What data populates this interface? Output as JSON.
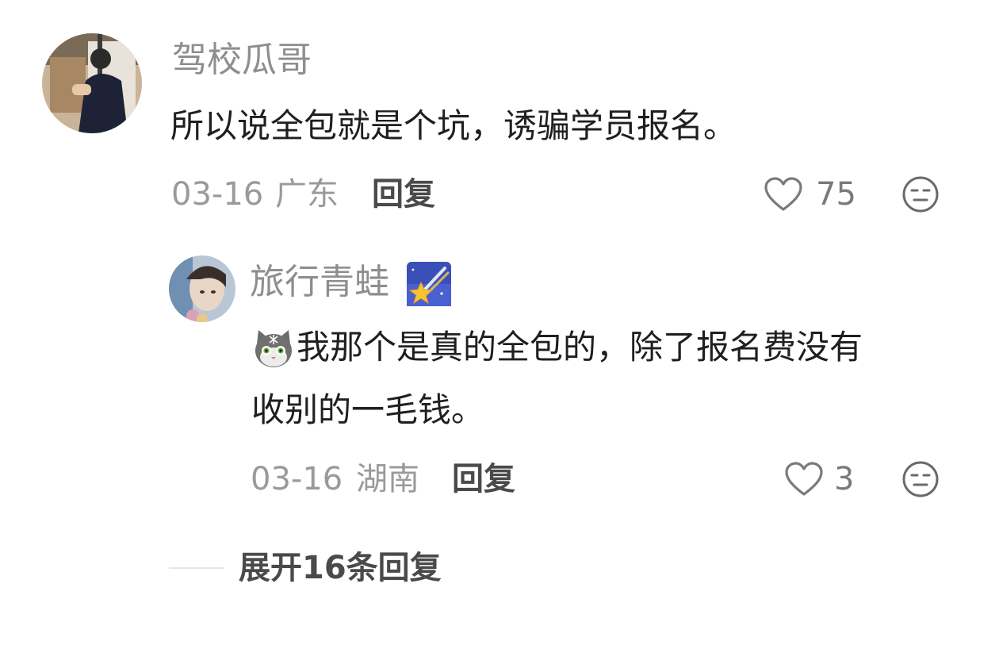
{
  "comment": {
    "username": "驾校瓜哥",
    "text": "所以说全包就是个坑，诱骗学员报名。",
    "date": "03-16",
    "location": "广东",
    "reply_label": "回复",
    "likes": "75"
  },
  "reply": {
    "username": "旅行青蛙",
    "username_emoji": "shooting-star-emoji",
    "text_emoji": "cat-face-emoji",
    "text_line1": "我那个是真的全包的，除了报名费没有",
    "text_line2": "收别的一毛钱。",
    "date": "03-16",
    "location": "湖南",
    "reply_label": "回复",
    "likes": "3"
  },
  "expand": {
    "label": "展开16条回复"
  },
  "colors": {
    "username": "#8e8e8e",
    "text": "#1f1f1f",
    "meta": "#9a9a9a",
    "action": "#4a4a4a"
  }
}
